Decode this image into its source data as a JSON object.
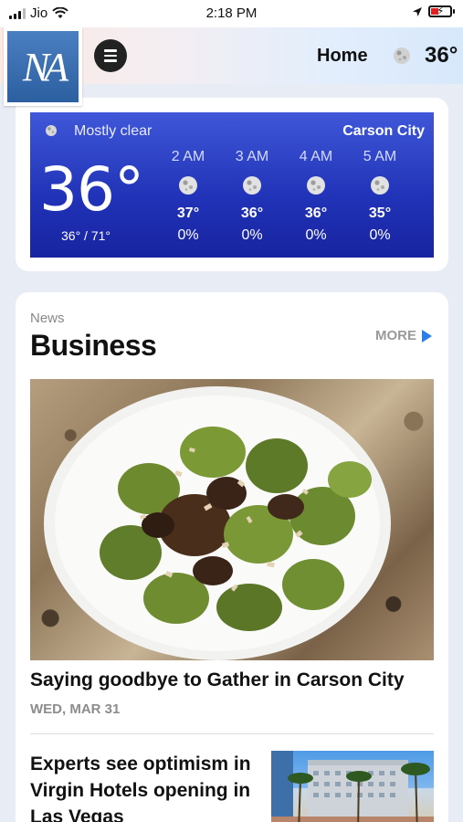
{
  "status_bar": {
    "carrier": "Jio",
    "time": "2:18 PM"
  },
  "header": {
    "logo_text": "NA",
    "home_label": "Home",
    "temperature": "36°",
    "weather_icon": "moon-icon"
  },
  "weather": {
    "condition": "Mostly clear",
    "city": "Carson City",
    "current_temp": "36°",
    "range": "36° / 71°",
    "hourly": [
      {
        "time": "2 AM",
        "temp": "37°",
        "precip": "0%",
        "icon": "moon-icon"
      },
      {
        "time": "3 AM",
        "temp": "36°",
        "precip": "0%",
        "icon": "moon-icon"
      },
      {
        "time": "4 AM",
        "temp": "36°",
        "precip": "0%",
        "icon": "moon-icon"
      },
      {
        "time": "5 AM",
        "temp": "35°",
        "precip": "0%",
        "icon": "moon-icon"
      }
    ]
  },
  "news": {
    "kicker": "News",
    "section": "Business",
    "more_label": "MORE",
    "articles": [
      {
        "title": "Saying goodbye to Gather in Carson City",
        "date": "WED, MAR 31"
      },
      {
        "title": "Experts see optimism in Virgin Hotels opening in Las Vegas"
      }
    ]
  },
  "colors": {
    "weather_panel": "#2a3cc4",
    "accent_arrow": "#2b7de9"
  }
}
